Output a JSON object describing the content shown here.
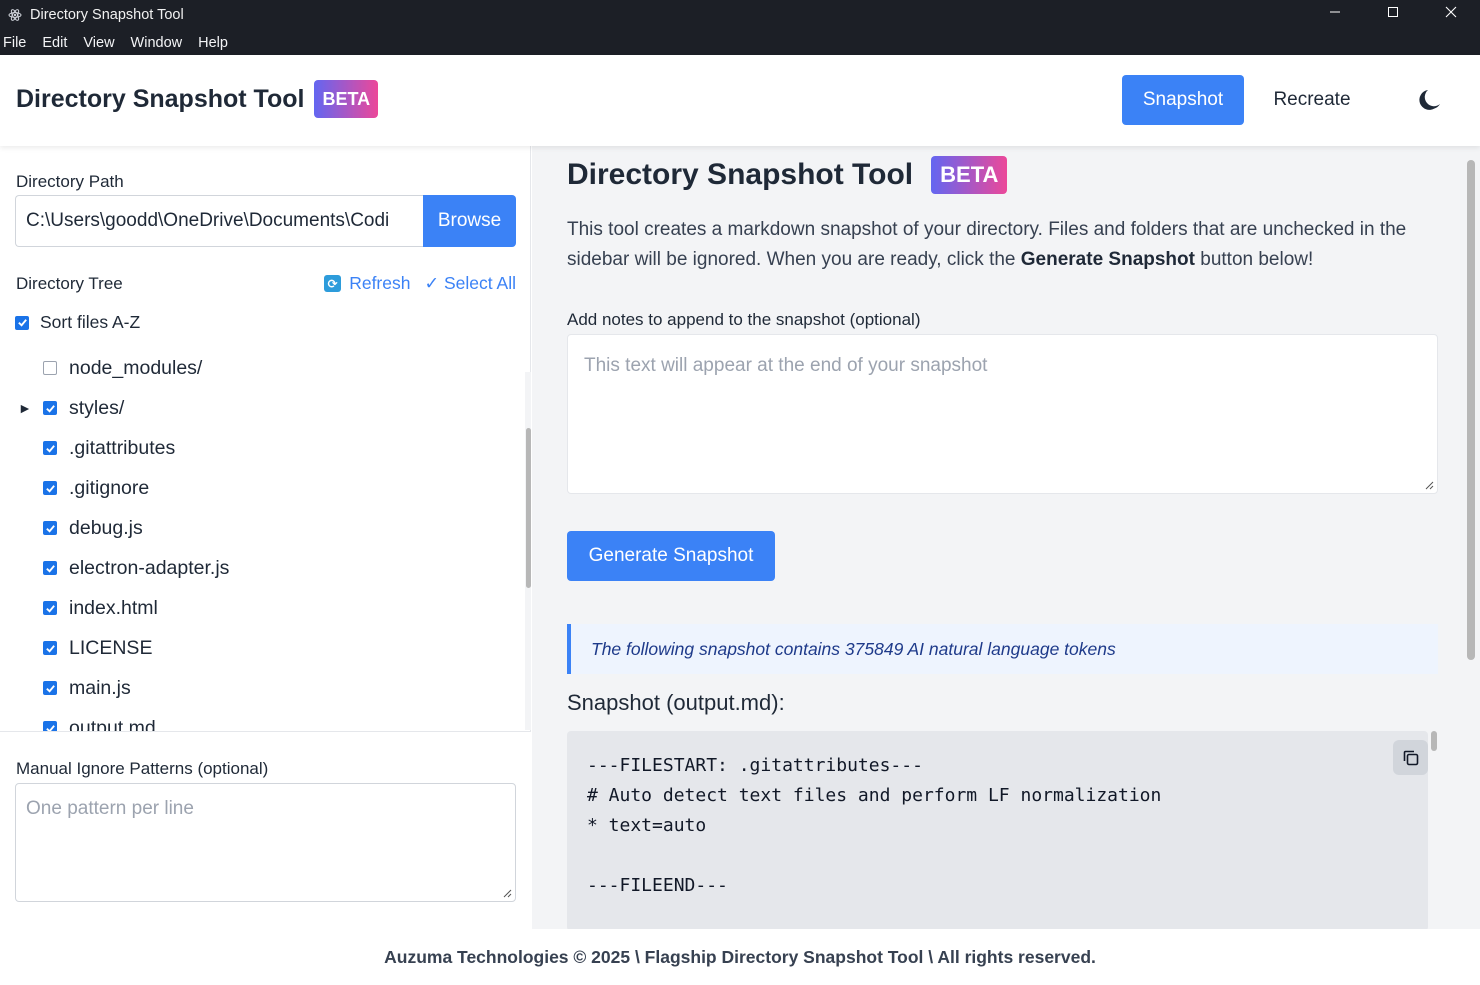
{
  "window": {
    "title": "Directory Snapshot Tool",
    "controls": [
      "minimize",
      "maximize",
      "close"
    ]
  },
  "menu": [
    "File",
    "Edit",
    "View",
    "Window",
    "Help"
  ],
  "header": {
    "brand": "Directory Snapshot Tool",
    "badge": "BETA",
    "nav_snapshot": "Snapshot",
    "nav_recreate": "Recreate",
    "theme_icon": "moon-icon"
  },
  "sidebar": {
    "dir_label": "Directory Path",
    "dir_value": "C:\\Users\\goodd\\OneDrive\\Documents\\Codi",
    "browse": "Browse",
    "tree_label": "Directory Tree",
    "refresh": "Refresh",
    "select_all": "✓ Select All",
    "sort_label": "Sort files A-Z",
    "tree": [
      {
        "name": "node_modules/",
        "checked": false,
        "folder": true
      },
      {
        "name": "styles/",
        "checked": true,
        "folder": true
      },
      {
        "name": ".gitattributes",
        "checked": true,
        "folder": false
      },
      {
        "name": ".gitignore",
        "checked": true,
        "folder": false
      },
      {
        "name": "debug.js",
        "checked": true,
        "folder": false
      },
      {
        "name": "electron-adapter.js",
        "checked": true,
        "folder": false
      },
      {
        "name": "index.html",
        "checked": true,
        "folder": false
      },
      {
        "name": "LICENSE",
        "checked": true,
        "folder": false
      },
      {
        "name": "main.js",
        "checked": true,
        "folder": false
      },
      {
        "name": "output.md",
        "checked": true,
        "folder": false
      }
    ],
    "ignore_label": "Manual Ignore Patterns (optional)",
    "ignore_placeholder": "One pattern per line"
  },
  "main": {
    "title": "Directory Snapshot Tool",
    "badge": "BETA",
    "intro_1": "This tool creates a markdown snapshot of your directory. Files and folders that are unchecked in the sidebar will be ignored. When you are ready, click the ",
    "intro_bold": "Generate Snapshot",
    "intro_2": " button below!",
    "notes_label": "Add notes to append to the snapshot (optional)",
    "notes_placeholder": "This text will appear at the end of your snapshot",
    "generate": "Generate Snapshot",
    "token_note": "The following snapshot contains 375849 AI natural language tokens",
    "snapshot_label": "Snapshot (output.md):",
    "code": "---FILESTART: .gitattributes---\n# Auto detect text files and perform LF normalization\n* text=auto\n\n---FILEEND---"
  },
  "footer": "Auzuma Technologies © 2025 \\ Flagship Directory Snapshot Tool \\ All rights reserved.",
  "colors": {
    "accent": "#3b82f6",
    "titlebar": "#1c1f26",
    "badge_from": "#6366f1",
    "badge_to": "#ec4899"
  }
}
